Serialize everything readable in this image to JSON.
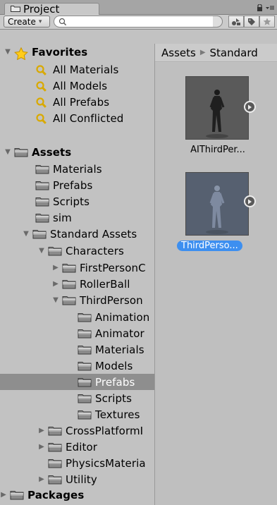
{
  "window": {
    "tab_title": "Project",
    "tab_icon": "folder-tab-icon",
    "lock_icon": "lock-icon",
    "menu_icon": "context-menu-icon"
  },
  "toolbar": {
    "create_label": "Create",
    "search_value": "",
    "search_placeholder": "",
    "buttons": [
      "filter-by-type-icon",
      "filter-by-label-icon",
      "favorite-star-icon"
    ]
  },
  "tree": {
    "favorites": {
      "label": "Favorites",
      "items": [
        "All Materials",
        "All Models",
        "All Prefabs",
        "All Conflicted"
      ]
    },
    "assets_label": "Assets",
    "assets_children": [
      "Materials",
      "Prefabs",
      "Scripts",
      "sim"
    ],
    "standard_assets_label": "Standard Assets",
    "characters_label": "Characters",
    "characters_children": [
      "FirstPersonC",
      "RollerBall"
    ],
    "third_person_label": "ThirdPerson",
    "third_person_children": [
      "Animation",
      "Animator",
      "Materials",
      "Models",
      "Prefabs",
      "Scripts",
      "Textures"
    ],
    "selected_item": "Prefabs",
    "standard_siblings": [
      "CrossPlatformI",
      "Editor",
      "PhysicsMateria",
      "Utility"
    ],
    "packages_label": "Packages"
  },
  "breadcrumb": [
    "Assets",
    "Standard"
  ],
  "assets_grid": [
    {
      "name": "AIThirdPer...",
      "selected": false
    },
    {
      "name": "ThirdPerso...",
      "selected": true
    }
  ],
  "colors": {
    "selection_blue": "#3d8ff0",
    "tree_selection": "#8e8e8e",
    "folder": "#7c7c7c",
    "search_icon": "#d9a900"
  }
}
